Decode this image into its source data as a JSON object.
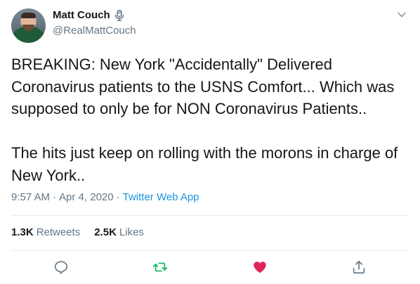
{
  "user": {
    "display_name": "Matt Couch",
    "handle": "@RealMattCouch",
    "avatar_icon": "avatar-photo",
    "badge_icon": "microphone-icon"
  },
  "tweet": {
    "text": "BREAKING: New York \"Accidentally\" Delivered Coronavirus patients to the USNS Comfort... Which was supposed to only be for NON Coronavirus Patients..\n\nThe hits just keep on rolling with the morons in charge of New York..",
    "time": "9:57 AM",
    "separator": "·",
    "date": "Apr 4, 2020",
    "separator2": "·",
    "source": "Twitter Web App"
  },
  "stats": {
    "retweets_count": "1.3K",
    "retweets_label": "Retweets",
    "likes_count": "2.5K",
    "likes_label": "Likes"
  },
  "actions": {
    "reply_icon": "reply-icon",
    "retweet_icon": "retweet-icon",
    "like_icon": "heart-icon",
    "share_icon": "share-icon"
  },
  "colors": {
    "text": "#14171a",
    "secondary": "#657786",
    "link": "#1b95e0",
    "retweet_active": "#17bf63",
    "like_active": "#e0245e",
    "divider": "#e6ecf0"
  }
}
